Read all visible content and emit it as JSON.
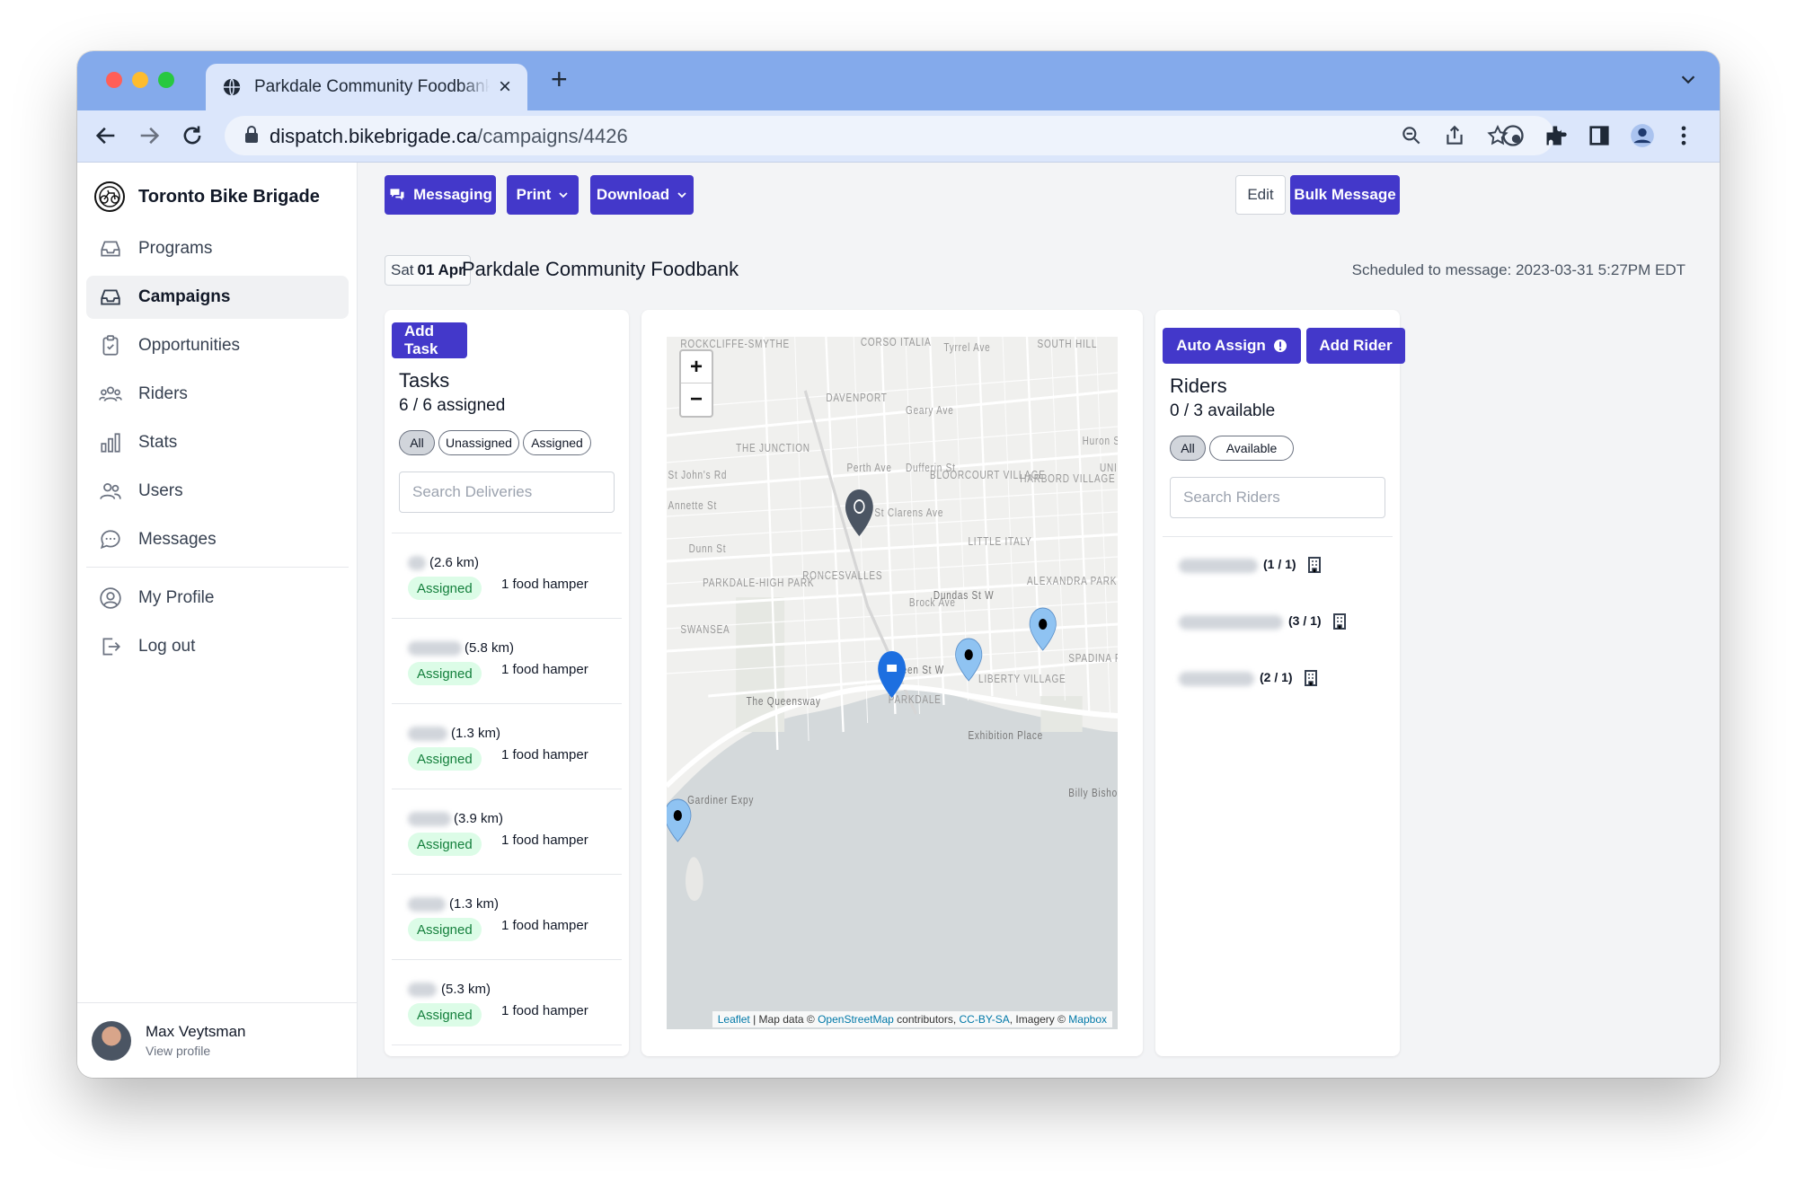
{
  "browser": {
    "tab_title": "Parkdale Community Foodbank",
    "url_host": "dispatch.bikebrigade.ca",
    "url_path": "/campaigns/4426"
  },
  "sidebar": {
    "brand": "Toronto Bike Brigade",
    "items": [
      {
        "label": "Programs",
        "icon": "inbox-icon"
      },
      {
        "label": "Campaigns",
        "icon": "tray-icon",
        "active": true
      },
      {
        "label": "Opportunities",
        "icon": "clipboard-icon"
      },
      {
        "label": "Riders",
        "icon": "users-group-icon"
      },
      {
        "label": "Stats",
        "icon": "bar-chart-icon"
      },
      {
        "label": "Users",
        "icon": "users-icon"
      },
      {
        "label": "Messages",
        "icon": "chat-icon"
      }
    ],
    "bottom_items": [
      {
        "label": "My Profile",
        "icon": "user-circle-icon"
      },
      {
        "label": "Log out",
        "icon": "logout-icon"
      }
    ],
    "user": {
      "name": "Max Veytsman",
      "sub": "View profile"
    }
  },
  "toolbar": {
    "messaging": "Messaging",
    "print": "Print",
    "download": "Download",
    "edit": "Edit",
    "bulk_message": "Bulk Message"
  },
  "campaign": {
    "date_dow": "Sat",
    "date_day": "01",
    "date_month": "Apr",
    "title": "Parkdale Community Foodbank",
    "scheduled": "Scheduled to message: 2023-03-31 5:27PM EDT"
  },
  "tasks": {
    "add_button": "Add Task",
    "title": "Tasks",
    "summary": "6 / 6 assigned",
    "filters": [
      "All",
      "Unassigned",
      "Assigned"
    ],
    "search_placeholder": "Search Deliveries",
    "items": [
      {
        "distance": "(2.6 km)",
        "status": "Assigned",
        "item": "1 food hamper"
      },
      {
        "distance": "(5.8 km)",
        "status": "Assigned",
        "item": "1 food hamper"
      },
      {
        "distance": "(1.3 km)",
        "status": "Assigned",
        "item": "1 food hamper"
      },
      {
        "distance": "(3.9 km)",
        "status": "Assigned",
        "item": "1 food hamper"
      },
      {
        "distance": "(1.3 km)",
        "status": "Assigned",
        "item": "1 food hamper"
      },
      {
        "distance": "(5.3 km)",
        "status": "Assigned",
        "item": "1 food hamper"
      }
    ]
  },
  "map": {
    "labels": [
      "ROCKCLIFFE-SMYTHE",
      "CORSO ITALIA",
      "Tyrrel Ave",
      "SOUTH HILL",
      "DAVENPORT",
      "Geary Ave",
      "THE JUNCTION",
      "St John's Rd",
      "Annette St",
      "BLOORCOURT VILLAGE",
      "HARBORD VILLAGE",
      "LITTLE ITALY",
      "PARKDALE-HIGH PARK",
      "RONCESVALLES",
      "Dundas St W",
      "ALEXANDRA PARK",
      "SWANSEA",
      "Queen St W",
      "LIBERTY VILLAGE",
      "PARKDALE",
      "The Queensway",
      "Exhibition Place",
      "Billy Bishop City Air",
      "Gardiner Expy",
      "Perth Ave",
      "Dufferin St",
      "St Clarens Ave",
      "Brock Ave",
      "Dunn St",
      "Huron St",
      "SPADINA FORT YORK",
      "UNI"
    ],
    "zoom_in": "+",
    "zoom_out": "−",
    "attr_leaflet": "Leaflet",
    "attr_mapdata": " | Map data © ",
    "attr_osm": "OpenStreetMap",
    "attr_contrib": " contributors, ",
    "attr_cc": "CC-BY-SA",
    "attr_imagery": ", Imagery © ",
    "attr_mapbox": "Mapbox"
  },
  "riders": {
    "auto_assign": "Auto Assign",
    "add_rider": "Add Rider",
    "title": "Riders",
    "summary": "0 / 3 available",
    "filters": [
      "All",
      "Available"
    ],
    "search_placeholder": "Search Riders",
    "items": [
      {
        "count": "(1 / 1)"
      },
      {
        "count": "(3 / 1)"
      },
      {
        "count": "(2 / 1)"
      }
    ]
  },
  "colors": {
    "primary": "#4338ca",
    "assigned_bg": "#dcfce7",
    "assigned_text": "#15803d",
    "tabbar": "#84aaeb"
  }
}
